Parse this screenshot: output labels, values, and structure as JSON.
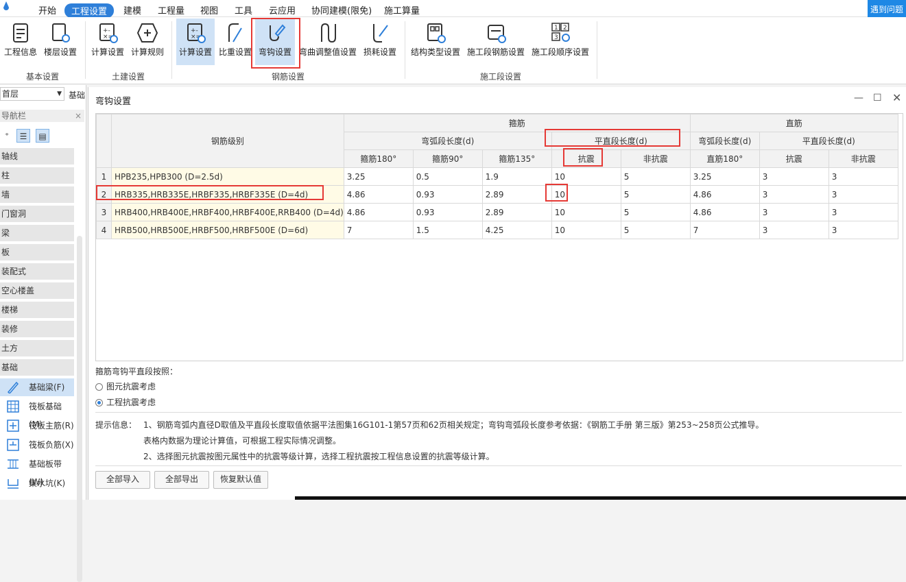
{
  "menubar": {
    "tabs": [
      "开始",
      "工程设置",
      "建模",
      "工程量",
      "视图",
      "工具",
      "云应用",
      "协同建模(限免)",
      "施工算量"
    ],
    "active_index": 1,
    "help": "遇到问题"
  },
  "ribbon": {
    "groups": {
      "basic": "基本设置",
      "civil": "土建设置",
      "rebar": "钢筋设置",
      "construction": "施工段设置"
    },
    "buttons": {
      "project_info": "工程信息",
      "floor_settings": "楼层设置",
      "civil_calc_settings": "计算设置",
      "civil_calc_rules": "计算规则",
      "rebar_calc_settings": "计算设置",
      "weight_settings": "比重设置",
      "hook_settings": "弯钩设置",
      "bend_adjust_settings": "弯曲调整值设置",
      "loss_settings": "损耗设置",
      "structure_type_settings": "结构类型设置",
      "section_rebar_settings": "施工段钢筋设置",
      "section_order_settings": "施工段顺序设置"
    }
  },
  "sidebar": {
    "floor": "首层",
    "basic_tab": "基础",
    "nav_title": "导航栏",
    "items": [
      "轴线",
      "柱",
      "墙",
      "门窗洞",
      "梁",
      "板",
      "装配式",
      "空心楼盖",
      "楼梯",
      "装修",
      "土方",
      "基础"
    ],
    "sub_items": [
      "基础梁(F)",
      "筏板基础(M)",
      "筏板主筋(R)",
      "筏板负筋(X)",
      "基础板带(W)",
      "集水坑(K)"
    ],
    "selected_sub": 0
  },
  "dialog": {
    "title": "弯钩设置",
    "table": {
      "h_grade": "钢筋级别",
      "h_stirrup": "箍筋",
      "h_straight": "直筋",
      "h_arc_len": "弯弧段长度(d)",
      "h_flat_len": "平直段长度(d)",
      "h_arc_len2": "弯弧段长度(d)",
      "h_flat_len2": "平直段长度(d)",
      "sub": [
        "箍筋180°",
        "箍筋90°",
        "箍筋135°",
        "抗震",
        "非抗震",
        "直筋180°",
        "抗震",
        "非抗震"
      ],
      "rows": [
        {
          "no": "1",
          "grade": "HPB235,HPB300 (D=2.5d)",
          "v": [
            "3.25",
            "0.5",
            "1.9",
            "10",
            "5",
            "3.25",
            "3",
            "3"
          ]
        },
        {
          "no": "2",
          "grade": "HRB335,HRB335E,HRBF335,HRBF335E (D=4d)",
          "v": [
            "4.86",
            "0.93",
            "2.89",
            "10",
            "5",
            "4.86",
            "3",
            "3"
          ]
        },
        {
          "no": "3",
          "grade": "HRB400,HRB400E,HRBF400,HRBF400E,RRB400 (D=4d)",
          "v": [
            "4.86",
            "0.93",
            "2.89",
            "10",
            "5",
            "4.86",
            "3",
            "3"
          ]
        },
        {
          "no": "4",
          "grade": "HRB500,HRB500E,HRBF500,HRBF500E (D=6d)",
          "v": [
            "7",
            "1.5",
            "4.25",
            "10",
            "5",
            "7",
            "3",
            "3"
          ]
        }
      ]
    },
    "option_title": "箍筋弯钩平直段按照：",
    "options": [
      "图元抗震考虑",
      "工程抗震考虑"
    ],
    "selected_option": 1,
    "tip_label": "提示信息：",
    "tips": [
      "1、钢筋弯弧内直径D取值及平直段长度取值依据平法图集16G101-1第57页和62页相关规定；弯钩弯弧段长度参考依据：《钢筋工手册  第三版》第253~258页公式推导。",
      "表格内数据为理论计算值，可根据工程实际情况调整。",
      "2、选择图元抗震按图元属性中的抗震等级计算，选择工程抗震按工程信息设置的抗震等级计算。"
    ],
    "buttons": {
      "import_all": "全部导入",
      "export_all": "全部导出",
      "restore_default": "恢复默认值"
    }
  },
  "colors": {
    "accent": "#2e7fd9",
    "highlight": "#e53935",
    "grade_bg": "#fffbe6"
  }
}
